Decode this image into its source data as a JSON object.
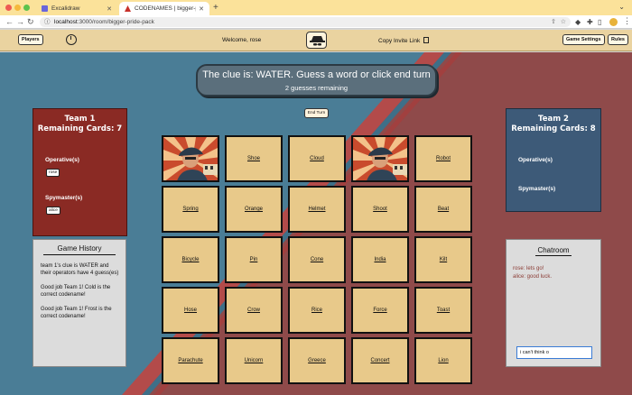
{
  "browser": {
    "tabs": [
      {
        "title": "Excalidraw"
      },
      {
        "title": "CODENAMES | bigger-pride-p"
      }
    ],
    "url": {
      "host": "localhost",
      "path": ":3000/room/bigger-pride-pack"
    }
  },
  "header": {
    "players_label": "Players",
    "welcome_text": "Welcome, rose",
    "invite_label": "Copy Invite Link",
    "settings_label": "Game Settings",
    "rules_label": "Rules"
  },
  "clue": {
    "text": "The clue is: WATER. Guess a word or click end turn",
    "remaining": "2 guesses remaining"
  },
  "end_turn_label": "End Turn",
  "team1": {
    "name": "Team 1",
    "remaining": "Remaining Cards: 7",
    "operatives_label": "Operative(s)",
    "operatives": [
      "rose"
    ],
    "spymasters_label": "Spymaster(s)",
    "spymasters": [
      "alice"
    ]
  },
  "team2": {
    "name": "Team 2",
    "remaining": "Remaining Cards: 8",
    "operatives_label": "Operative(s)",
    "spymasters_label": "Spymaster(s)"
  },
  "history": {
    "title": "Game History",
    "entries": [
      "team 1's clue is WATER and their operators have 4 guess(es)",
      "Good job Team 1! Cold is the correct codename!",
      "Good job Team 1! Frost is the correct codename!"
    ]
  },
  "chat": {
    "title": "Chatroom",
    "messages": [
      "rose: lets go!",
      "alice: good luck."
    ],
    "input_value": "i can't think o"
  },
  "board": {
    "cards": [
      {
        "word": "",
        "revealed": true
      },
      {
        "word": "Shoe",
        "revealed": false
      },
      {
        "word": "Cloud",
        "revealed": false
      },
      {
        "word": "",
        "revealed": true
      },
      {
        "word": "Robot",
        "revealed": false
      },
      {
        "word": "Spring",
        "revealed": false
      },
      {
        "word": "Orange",
        "revealed": false
      },
      {
        "word": "Helmet",
        "revealed": false
      },
      {
        "word": "Shoot",
        "revealed": false
      },
      {
        "word": "Beat",
        "revealed": false
      },
      {
        "word": "Bicycle",
        "revealed": false
      },
      {
        "word": "Pin",
        "revealed": false
      },
      {
        "word": "Cone",
        "revealed": false
      },
      {
        "word": "India",
        "revealed": false
      },
      {
        "word": "Kilt",
        "revealed": false
      },
      {
        "word": "Hose",
        "revealed": false
      },
      {
        "word": "Crow",
        "revealed": false
      },
      {
        "word": "Rice",
        "revealed": false
      },
      {
        "word": "Force",
        "revealed": false
      },
      {
        "word": "Toast",
        "revealed": false
      },
      {
        "word": "Parachute",
        "revealed": false
      },
      {
        "word": "Unicorn",
        "revealed": false
      },
      {
        "word": "Greece",
        "revealed": false
      },
      {
        "word": "Concert",
        "revealed": false
      },
      {
        "word": "Lion",
        "revealed": false
      }
    ]
  }
}
